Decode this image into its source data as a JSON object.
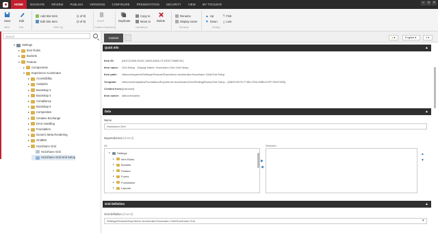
{
  "menubar": {
    "tabs": [
      "HOME",
      "NAVIGATE",
      "REVIEW",
      "PUBLISH",
      "VERSIONS",
      "CONFIGURE",
      "PRESENTATION",
      "SECURITY",
      "VIEW",
      "MY TOOLBAR"
    ],
    "active_tab": "HOME"
  },
  "ribbon": {
    "save": "Save",
    "edit": "Edit",
    "add_site_item": "Add Site Item",
    "add_site_item_count": "(1 of 9)",
    "edit_site_item": "Edit Site Item",
    "edit_site_item_count": "(2 of 9)",
    "insert": "Insert",
    "duplicate": "Duplicate",
    "copy_to": "Copy to",
    "move_to": "Move to",
    "delete": "Delete",
    "rename": "Rename",
    "display_name": "Display name",
    "up": "Up",
    "down": "Down",
    "first": "First",
    "last": "Last",
    "group_write": "Write",
    "group_edit": "Edit",
    "group_helix": "Helix Lig",
    "group_custom": "Custom Experience",
    "group_operations": "Operations",
    "group_rename": "Rename",
    "group_sorting": "Sorting"
  },
  "left_panel": {
    "search_placeholder": "Search",
    "tree": [
      {
        "label": "Settings",
        "depth": 0,
        "expanded": true,
        "icon": "gear-icon"
      },
      {
        "label": "Item Rules",
        "depth": 1,
        "expanded": false,
        "icon": "folder-icon"
      },
      {
        "label": "Buckets",
        "depth": 1,
        "expanded": false,
        "icon": "folder-icon"
      },
      {
        "label": "Feature",
        "depth": 1,
        "expanded": true,
        "icon": "folder-icon"
      },
      {
        "label": "Components",
        "depth": 2,
        "expanded": false,
        "icon": "folder-icon"
      },
      {
        "label": "Experience Accelerator",
        "depth": 2,
        "expanded": true,
        "icon": "folder-icon"
      },
      {
        "label": "Accessibility",
        "depth": 3,
        "expanded": false,
        "icon": "folder-icon"
      },
      {
        "label": "Analytics",
        "depth": 3,
        "expanded": false,
        "icon": "folder-icon"
      },
      {
        "label": "Bootstrap 3",
        "depth": 3,
        "expanded": false,
        "icon": "folder-icon"
      },
      {
        "label": "Bootstrap 4",
        "depth": 3,
        "expanded": false,
        "icon": "folder-icon"
      },
      {
        "label": "Compliancy",
        "depth": 3,
        "expanded": false,
        "icon": "folder-icon"
      },
      {
        "label": "Bootstrap 5",
        "depth": 3,
        "expanded": false,
        "icon": "folder-icon"
      },
      {
        "label": "Composites",
        "depth": 3,
        "expanded": false,
        "icon": "folder-icon"
      },
      {
        "label": "Creative Exchange",
        "depth": 3,
        "expanded": false,
        "icon": "folder-icon"
      },
      {
        "label": "Error Handling",
        "depth": 3,
        "expanded": false,
        "icon": "folder-icon"
      },
      {
        "label": "Foundation",
        "depth": 3,
        "expanded": false,
        "icon": "folder-icon"
      },
      {
        "label": "Generic Meta Rendering",
        "depth": 3,
        "expanded": false,
        "icon": "folder-icon"
      },
      {
        "label": "Grid960",
        "depth": 3,
        "expanded": false,
        "icon": "folder-icon"
      },
      {
        "label": "Hozizhann Grid",
        "depth": 3,
        "expanded": true,
        "icon": "folder-icon"
      },
      {
        "label": "Hozizhann Grid",
        "depth": 4,
        "expanded": null,
        "icon": "grid-icon"
      },
      {
        "label": "Hozizhann Grid Grid Setup",
        "depth": 4,
        "expanded": null,
        "icon": "grid-setup-icon",
        "selected": true
      }
    ]
  },
  "content": {
    "tab_label": "Content",
    "language": "English",
    "version": "1",
    "quick_info": {
      "title": "Quick Info",
      "rows": [
        {
          "key": "Item ID:",
          "value": "{DDC22305-EDAC-4050-A05A-CF1EDC7869E1E}"
        },
        {
          "key": "Item name:",
          "value": "Grid Setup - Display Name: Hozizhann Grid Grid Setup"
        },
        {
          "key": "Item path:",
          "value": "/sitecore/system/Settings/Feature/Experience Accelerator/Hozizhann Grid/Grid Setup"
        },
        {
          "key": "Template:",
          "value": "/sitecore/templates/Foundation/Experience Accelerator/Grid/Rolling/Roots/Grid Setup - {DBDF0D7D-F76B-4766-99B8-E2FF7509732B}"
        },
        {
          "key": "Created from:",
          "value": "[unknown]"
        },
        {
          "key": "Item owner:",
          "value": "sitecore\\Admin"
        }
      ]
    },
    "data": {
      "title": "Data",
      "name_label": "Name",
      "name_value": "Hozizhann Grid",
      "deps_label": "Dependencies",
      "deps_shared": "[shared]",
      "all_label": "All",
      "selected_label": "Selected",
      "all_tree": [
        {
          "label": "Settings",
          "depth": 0,
          "expanded": true
        },
        {
          "label": "Item Rules",
          "depth": 1,
          "expanded": false
        },
        {
          "label": "Buckets",
          "depth": 1,
          "expanded": false
        },
        {
          "label": "Feature",
          "depth": 1,
          "expanded": false
        },
        {
          "label": "Forms",
          "depth": 1,
          "expanded": false
        },
        {
          "label": "Foundation",
          "depth": 1,
          "expanded": false
        },
        {
          "label": "Layouts",
          "depth": 1,
          "expanded": false
        }
      ]
    },
    "grid_definition": {
      "title": "Grid Definition",
      "field_label": "Grid definition",
      "field_shared": "[shared]",
      "field_value": "Settings/Feature/Experience Accelerator/Hozizhann Grid/Hozizhann Grid"
    }
  }
}
